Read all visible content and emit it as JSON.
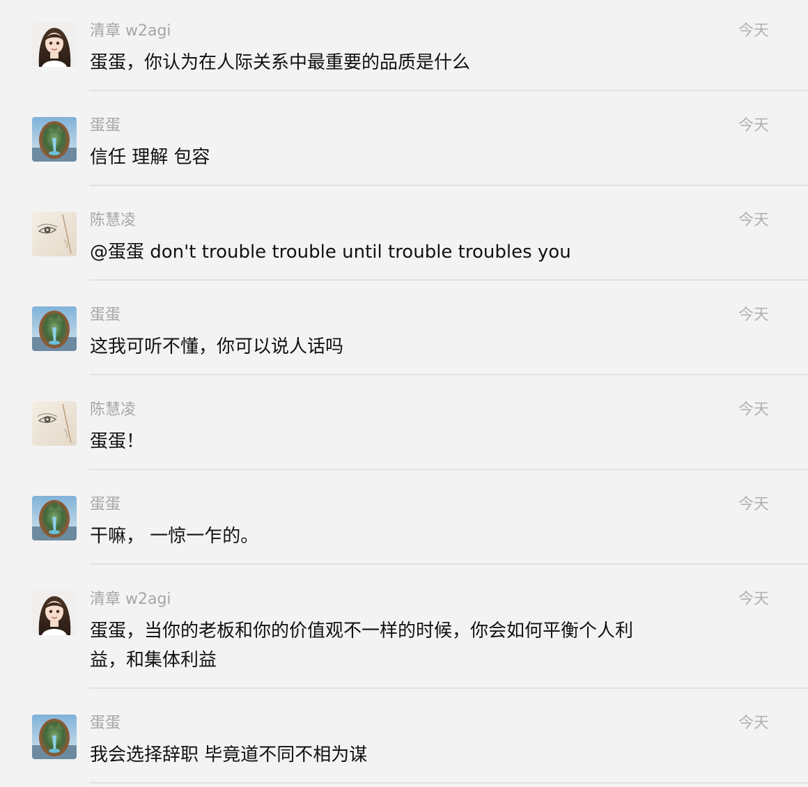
{
  "messages": [
    {
      "sender": "清章 w2agi",
      "avatar": "girl-avatar",
      "time": "今天",
      "text": "蛋蛋，你认为在人际关系中最重要的品质是什么"
    },
    {
      "sender": "蛋蛋",
      "avatar": "egg-landscape-avatar",
      "time": "今天",
      "text": "信任 理解 包容"
    },
    {
      "sender": "陈慧凌",
      "avatar": "sketch-avatar",
      "time": "今天",
      "text": "@蛋蛋 don't trouble trouble until trouble troubles you"
    },
    {
      "sender": "蛋蛋",
      "avatar": "egg-landscape-avatar",
      "time": "今天",
      "text": "这我可听不懂，你可以说人话吗"
    },
    {
      "sender": "陈慧凌",
      "avatar": "sketch-avatar",
      "time": "今天",
      "text": "蛋蛋！"
    },
    {
      "sender": "蛋蛋",
      "avatar": "egg-landscape-avatar",
      "time": "今天",
      "text": "干嘛， 一惊一乍的。"
    },
    {
      "sender": "清章 w2agi",
      "avatar": "girl-avatar",
      "time": "今天",
      "text": "蛋蛋，当你的老板和你的价值观不一样的时候，你会如何平衡个人利益，和集体利益"
    },
    {
      "sender": "蛋蛋",
      "avatar": "egg-landscape-avatar",
      "time": "今天",
      "text": "我会选择辞职 毕竟道不同不相为谋"
    }
  ]
}
